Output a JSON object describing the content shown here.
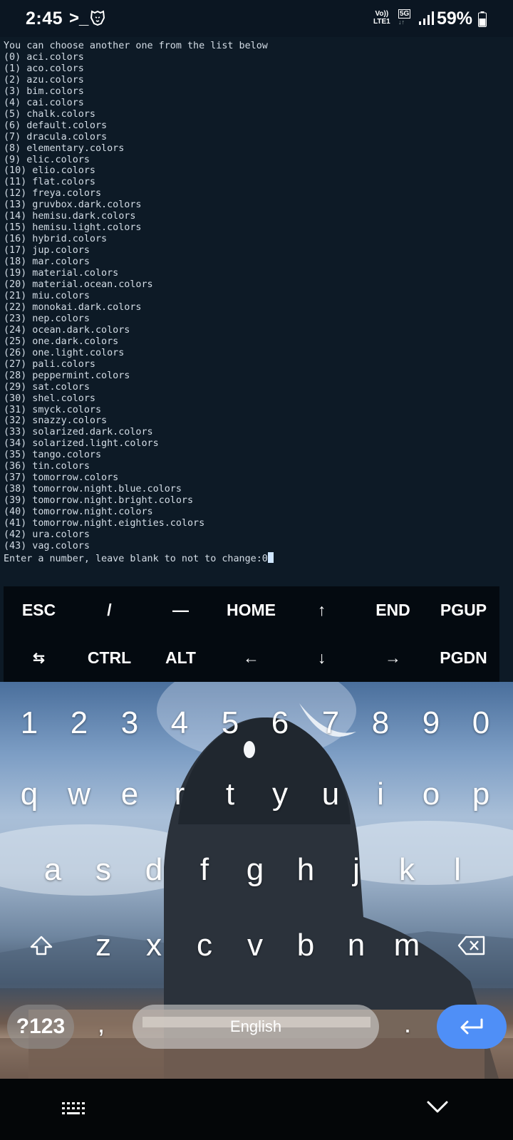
{
  "status_bar": {
    "time": "2:45",
    "prompt_glyph": ">_",
    "volte_top": "Vo))",
    "volte_bottom": "LTE1",
    "network": "5G",
    "network_arrows": "↓↑",
    "battery": "59%"
  },
  "terminal": {
    "lines": [
      "You can choose another one from the list below",
      "(0) aci.colors",
      "(1) aco.colors",
      "(2) azu.colors",
      "(3) bim.colors",
      "(4) cai.colors",
      "(5) chalk.colors",
      "(6) default.colors",
      "(7) dracula.colors",
      "(8) elementary.colors",
      "(9) elic.colors",
      "(10) elio.colors",
      "(11) flat.colors",
      "(12) freya.colors",
      "(13) gruvbox.dark.colors",
      "(14) hemisu.dark.colors",
      "(15) hemisu.light.colors",
      "(16) hybrid.colors",
      "(17) jup.colors",
      "(18) mar.colors",
      "(19) material.colors",
      "(20) material.ocean.colors",
      "(21) miu.colors",
      "(22) monokai.dark.colors",
      "(23) nep.colors",
      "(24) ocean.dark.colors",
      "(25) one.dark.colors",
      "(26) one.light.colors",
      "(27) pali.colors",
      "(28) peppermint.colors",
      "(29) sat.colors",
      "(30) shel.colors",
      "(31) smyck.colors",
      "(32) snazzy.colors",
      "(33) solarized.dark.colors",
      "(34) solarized.light.colors",
      "(35) tango.colors",
      "(36) tin.colors",
      "(37) tomorrow.colors",
      "(38) tomorrow.night.blue.colors",
      "(39) tomorrow.night.bright.colors",
      "(40) tomorrow.night.colors",
      "(41) tomorrow.night.eighties.colors",
      "(42) ura.colors",
      "(43) vag.colors"
    ],
    "prompt": "Enter a number, leave blank to not to change:",
    "input_value": "0"
  },
  "extra_keys": {
    "row1": [
      "ESC",
      "/",
      "—",
      "HOME",
      "↑",
      "END",
      "PGUP"
    ],
    "row2": [
      "⇆",
      "CTRL",
      "ALT",
      "←",
      "↓",
      "→",
      "PGDN"
    ]
  },
  "keyboard": {
    "number_row": [
      "1",
      "2",
      "3",
      "4",
      "5",
      "6",
      "7",
      "8",
      "9",
      "0"
    ],
    "row_q": [
      "q",
      "w",
      "e",
      "r",
      "t",
      "y",
      "u",
      "i",
      "o",
      "p"
    ],
    "row_a": [
      "a",
      "s",
      "d",
      "f",
      "g",
      "h",
      "j",
      "k",
      "l"
    ],
    "row_z": [
      "z",
      "x",
      "c",
      "v",
      "b",
      "n",
      "m"
    ],
    "symbols_label": "?123",
    "comma": ",",
    "space_label": "English",
    "period": ".",
    "enter_glyph": "↵"
  },
  "icons": {
    "status": [
      "terminal-prompt-icon",
      "lion-icon",
      "signal-icon",
      "battery-icon"
    ],
    "keyboard": [
      "shift-icon",
      "backspace-icon",
      "enter-icon"
    ],
    "nav": [
      "keyboard-switch-icon",
      "chevron-down-icon"
    ]
  },
  "colors": {
    "terminal_bg": "#0d1a26",
    "terminal_fg": "#d4dde6",
    "cursor": "#cfe6ff",
    "extra_keys_bg": "#040a10",
    "enter_key": "#4f8ff7",
    "nav_bg": "#040608"
  }
}
